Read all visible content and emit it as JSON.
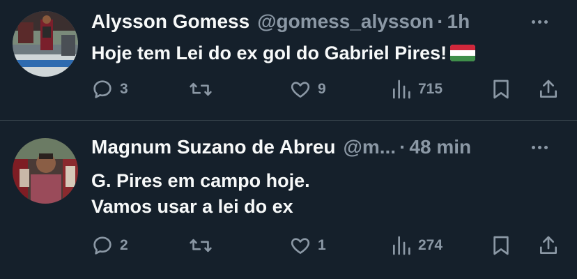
{
  "colors": {
    "background": "#15202b",
    "text_primary": "#f7f9f9",
    "text_secondary": "#8b98a5",
    "divider": "#38444d"
  },
  "tweets": [
    {
      "name": "Alysson Gomess",
      "handle": "@gomess_alysson",
      "separator": "·",
      "time": "1h",
      "text_lines": [
        "Hoje tem Lei do ex gol do Gabriel Pires!"
      ],
      "emoji": "hungary-flag-icon",
      "replies": "3",
      "retweets": "",
      "likes": "9",
      "views": "715"
    },
    {
      "name": "Magnum Suzano de Abreu",
      "handle": "@m...",
      "separator": "·",
      "time": "48 min",
      "text_lines": [
        "G. Pires em campo hoje.",
        "Vamos usar a lei do ex"
      ],
      "replies": "2",
      "retweets": "",
      "likes": "1",
      "views": "274"
    }
  ]
}
